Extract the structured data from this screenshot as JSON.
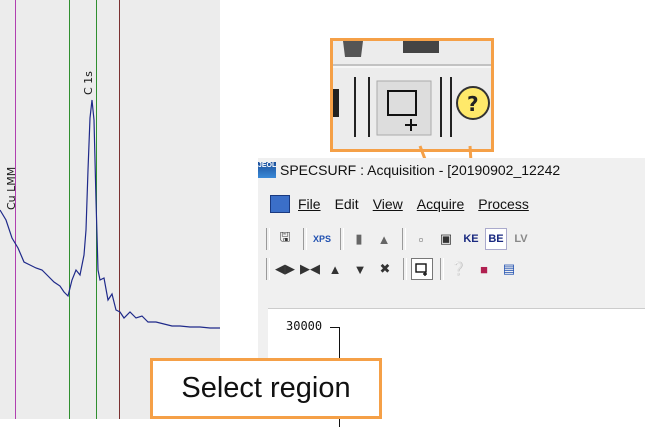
{
  "spectrum": {
    "peak_label_c1s": "C 1s",
    "peak_label_cu": "Cu LMM"
  },
  "app": {
    "title": "SPECSURF : Acquisition  - [20190902_12242",
    "menus": [
      "File",
      "Edit",
      "View",
      "Acquire",
      "Process"
    ],
    "toolbar1": {
      "ke_label": "KE",
      "be_label": "BE",
      "lv_label": "LV"
    },
    "y_axis_value": "30000"
  },
  "callout": {
    "text": "Select region"
  },
  "colors": {
    "accent_orange": "#f5a047",
    "spectrum_line": "#1f2a8a",
    "green_line": "#2f8f2f",
    "magenta_line": "#b040b0",
    "maroon_line": "#7a3030"
  }
}
